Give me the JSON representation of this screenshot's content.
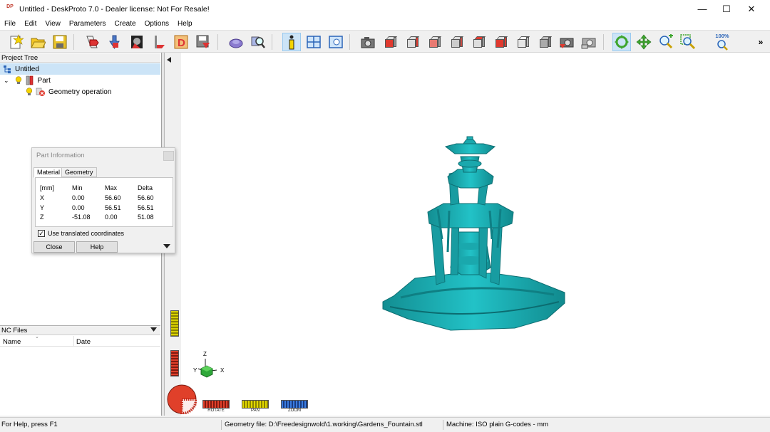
{
  "window": {
    "logo": "DP",
    "title": "Untitled - DeskProto 7.0 - Dealer license: Not For Resale!",
    "minimize": "—",
    "maximize": "☐",
    "close": "✕"
  },
  "menu": [
    "File",
    "Edit",
    "View",
    "Parameters",
    "Create",
    "Options",
    "Help"
  ],
  "toolbar": {
    "zoom_percent": "100%",
    "overflow": "»",
    "buttons": [
      {
        "icon": "new-project-icon"
      },
      {
        "icon": "open-folder-icon"
      },
      {
        "icon": "save-disk-icon"
      },
      {
        "icon": "load-geometry-icon"
      },
      {
        "icon": "load-part-icon"
      },
      {
        "icon": "bitmap-icon"
      },
      {
        "icon": "vector-icon"
      },
      {
        "icon": "deskproto-d-icon"
      },
      {
        "icon": "save-as-icon"
      },
      {
        "icon": "shaded-part-icon"
      },
      {
        "icon": "part-search-icon"
      },
      {
        "icon": "information-icon",
        "active": true
      },
      {
        "icon": "window-split-icon"
      },
      {
        "icon": "preview-window-icon"
      },
      {
        "icon": "camera-icon"
      },
      {
        "icon": "view-cube-front-icon"
      },
      {
        "icon": "view-cube-right-icon"
      },
      {
        "icon": "view-cube-left-icon"
      },
      {
        "icon": "view-cube-back-icon"
      },
      {
        "icon": "view-cube-top-icon"
      },
      {
        "icon": "view-cube-bottom-icon"
      },
      {
        "icon": "view-cube-iso-icon"
      },
      {
        "icon": "view-cube-grey-icon"
      },
      {
        "icon": "camera-red-icon"
      },
      {
        "icon": "camera-grey-icon"
      },
      {
        "icon": "rotate-mode-icon",
        "active": true
      },
      {
        "icon": "pan-mode-icon"
      },
      {
        "icon": "zoom-in-icon"
      },
      {
        "icon": "zoom-window-icon"
      },
      {
        "icon": "zoom-100-icon"
      }
    ]
  },
  "project_tree": {
    "header": "Project Tree",
    "root": "Untitled",
    "part": "Part",
    "operation": "Geometry operation"
  },
  "nc_files": {
    "header": "NC Files",
    "col_name": "Name",
    "col_date": "Date"
  },
  "part_info": {
    "title": "Part Information",
    "tabs": [
      "Material",
      "Geometry"
    ],
    "headers": [
      "[mm]",
      "Min",
      "Max",
      "Delta"
    ],
    "rows": [
      [
        "X",
        "0.00",
        "56.60",
        "56.60"
      ],
      [
        "Y",
        "0.00",
        "56.51",
        "56.51"
      ],
      [
        "Z",
        "-51.08",
        "0.00",
        "51.08"
      ]
    ],
    "checkbox_label": "Use translated coordinates",
    "checkbox_checked": true,
    "close_label": "Close",
    "help_label": "Help"
  },
  "viewport": {
    "model_color": "#1fb3b8",
    "axis_z": "Z",
    "axis_y": "Y",
    "axis_x": "X",
    "rotate_label": "ROTATE",
    "pan_label": "PAN",
    "zoom_label": "ZOOM"
  },
  "status": {
    "help": "For Help, press F1",
    "geometry": "Geometry file: D:\\Freedesignwold\\1.working\\Gardens_Fountain.stl",
    "machine": "Machine: ISO plain G-codes - mm"
  }
}
